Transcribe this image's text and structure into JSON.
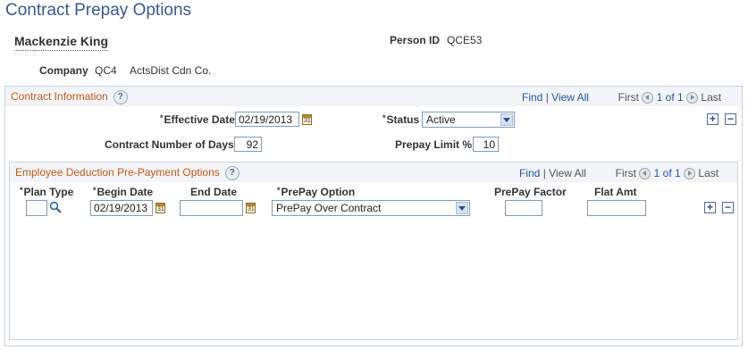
{
  "page": {
    "title": "Contract Prepay Options"
  },
  "header": {
    "name": "Mackenzie King",
    "person_id_label": "Person ID",
    "person_id": "QCE53",
    "company_label": "Company",
    "company_code": "QC4",
    "company_name": "ActsDist Cdn Co."
  },
  "contract": {
    "title": "Contract Information",
    "nav": {
      "find": "Find",
      "sep": "|",
      "view_all": "View All",
      "first": "First",
      "count": "1 of 1",
      "last": "Last"
    },
    "effective_date_label": "Effective Date",
    "effective_date": "02/19/2013",
    "status_label": "Status",
    "status": "Active",
    "days_label": "Contract Number of Days",
    "days": "92",
    "limit_label": "Prepay Limit %",
    "limit": "10"
  },
  "prepay": {
    "title": "Employee Deduction Pre-Payment Options",
    "nav": {
      "find": "Find",
      "sep": "|",
      "view_all": "View All",
      "first": "First",
      "count": "1 of 1",
      "last": "Last"
    },
    "columns": {
      "plan_type": "Plan Type",
      "begin_date": "Begin Date",
      "end_date": "End Date",
      "prepay_option": "PrePay Option",
      "prepay_factor": "PrePay Factor",
      "flat_amt": "Flat Amt"
    },
    "row": {
      "plan_type": "",
      "begin_date": "02/19/2013",
      "end_date": "",
      "prepay_option": "PrePay Over Contract",
      "prepay_factor": "",
      "flat_amt": ""
    }
  },
  "icons": {
    "add": "+",
    "delete": "−",
    "calendar": "31",
    "help": "?",
    "required": "*"
  }
}
